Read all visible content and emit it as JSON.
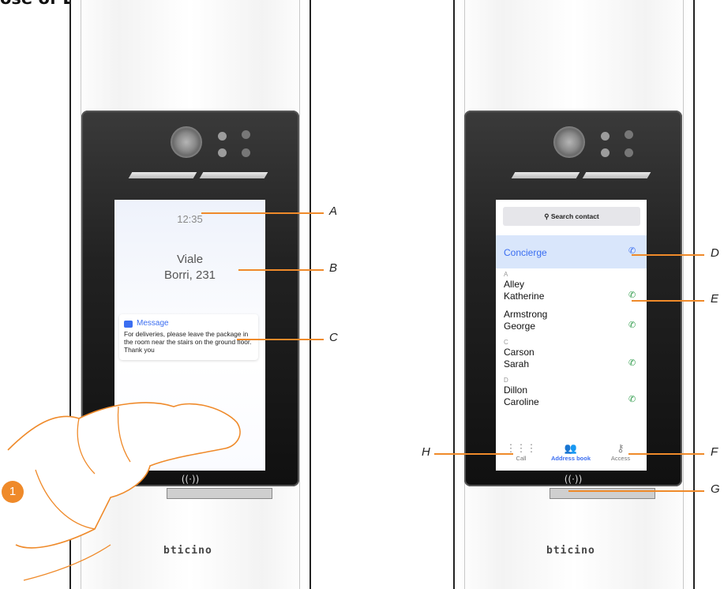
{
  "heading": "ose of EP",
  "brand": "bticino",
  "left_screen": {
    "time": "12:35",
    "address_line1": "Viale",
    "address_line2": "Borri, 231",
    "message_title": "Message",
    "message_text": "For deliveries, please leave the package in the room near the stairs on the ground floor. Thank you",
    "touch_icon": "pointer-hand-icon",
    "nfc_icon": "((·))"
  },
  "right_screen": {
    "search_label": "Search contact",
    "concierge": "Concierge",
    "sections": [
      {
        "letter": "A",
        "contacts": [
          "Alley\nKatherine",
          "Armstrong\nGeorge"
        ]
      },
      {
        "letter": "C",
        "contacts": [
          "Carson\nSarah"
        ]
      },
      {
        "letter": "D",
        "contacts": [
          "Dillon\nCaroline"
        ]
      }
    ],
    "contact_lines": {
      "alley1": "Alley",
      "alley2": "Katherine",
      "armstrong1": "Armstrong",
      "armstrong2": "George",
      "carson1": "Carson",
      "carson2": "Sarah",
      "dillon1": "Dillon",
      "dillon2": "Caroline"
    },
    "letters": {
      "a": "A",
      "c": "C",
      "d": "D"
    },
    "tabs": {
      "call": "Call",
      "address_book": "Address book",
      "access": "Access"
    },
    "nfc_icon": "((·))"
  },
  "callouts": {
    "A": "A",
    "B": "B",
    "C": "C",
    "D": "D",
    "E": "E",
    "F": "F",
    "G": "G",
    "H": "H"
  },
  "step_number": "1",
  "colors": {
    "accent_orange": "#ef8a2a",
    "screen_blue": "#3b6ef1",
    "call_green": "#2e9b4a"
  }
}
